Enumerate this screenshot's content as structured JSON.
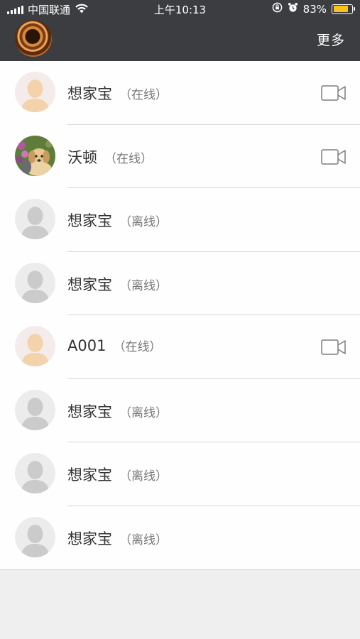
{
  "status_bar": {
    "carrier": "中国联通",
    "time": "上午10:13",
    "battery_percent": "83%",
    "battery_level": 0.83,
    "battery_color": "#f7c21a",
    "icons": [
      "signal-icon",
      "wifi-icon",
      "orientation-lock-icon",
      "alarm-icon",
      "battery-icon"
    ]
  },
  "header": {
    "avatar_icon": "profile-avatar",
    "more_label": "更多",
    "background": "#3b3d40"
  },
  "contacts": [
    {
      "name": "想家宝",
      "status": "（在线）",
      "online": true,
      "avatar": "default-avatar-skin",
      "video": true
    },
    {
      "name": "沃顿",
      "status": "（在线）",
      "online": true,
      "avatar": "puppy-photo",
      "video": true
    },
    {
      "name": "想家宝",
      "status": "（离线）",
      "online": false,
      "avatar": "default-avatar-gray",
      "video": false
    },
    {
      "name": "想家宝",
      "status": "（离线）",
      "online": false,
      "avatar": "default-avatar-gray",
      "video": false
    },
    {
      "name": "A001",
      "status": "（在线）",
      "online": true,
      "avatar": "default-avatar-skin",
      "video": true
    },
    {
      "name": "想家宝",
      "status": "（离线）",
      "online": false,
      "avatar": "default-avatar-gray",
      "video": false
    },
    {
      "name": "想家宝",
      "status": "（离线）",
      "online": false,
      "avatar": "default-avatar-gray",
      "video": false
    },
    {
      "name": "想家宝",
      "status": "（离线）",
      "online": false,
      "avatar": "default-avatar-gray",
      "video": false
    }
  ]
}
